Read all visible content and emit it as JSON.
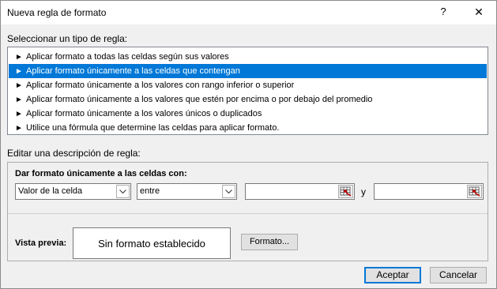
{
  "window": {
    "title": "Nueva regla de formato",
    "help_glyph": "?",
    "close_glyph": "✕"
  },
  "rule_type": {
    "label": "Seleccionar un tipo de regla:",
    "items": [
      {
        "label": "Aplicar formato a todas las celdas según sus valores",
        "selected": false
      },
      {
        "label": "Aplicar formato únicamente a las celdas que contengan",
        "selected": true
      },
      {
        "label": "Aplicar formato únicamente a los valores con rango inferior o superior",
        "selected": false
      },
      {
        "label": "Aplicar formato únicamente a los valores que estén por encima o por debajo del promedio",
        "selected": false
      },
      {
        "label": "Aplicar formato únicamente a los valores únicos o duplicados",
        "selected": false
      },
      {
        "label": "Utilice una fórmula que determine las celdas para aplicar formato.",
        "selected": false
      }
    ],
    "arrow_glyph": "►"
  },
  "description": {
    "label": "Editar una descripción de regla:",
    "heading": "Dar formato únicamente a las celdas con:",
    "condition_select": "Valor de la celda",
    "operator_select": "entre",
    "value1": "",
    "and_label": "y",
    "value2": ""
  },
  "preview": {
    "label": "Vista previa:",
    "text": "Sin formato establecido",
    "format_button": "Formato..."
  },
  "buttons": {
    "accept": "Aceptar",
    "cancel": "Cancelar"
  },
  "colors": {
    "selection": "#0078d7",
    "dialog_bg": "#f0f0f0"
  }
}
